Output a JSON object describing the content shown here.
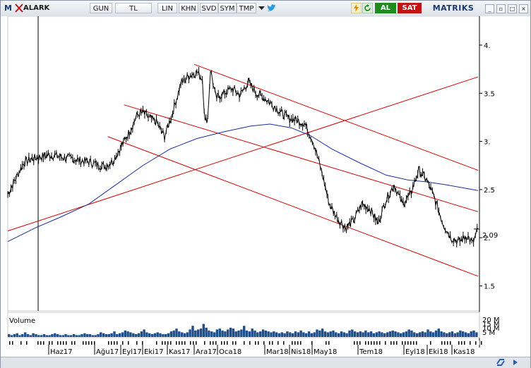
{
  "toolbar": {
    "menu_logo": "M",
    "symbol": "ALARK",
    "period": "GUN",
    "currency": "TL",
    "scale": "LIN",
    "khn": "KHN",
    "svd": "SVD",
    "sym": "SYM",
    "tmp": "TMP",
    "buy_label": "AL",
    "sell_label": "SAT",
    "brand": "MATRIKS",
    "icons": [
      "twitter-icon",
      "lightning-icon",
      "refresh-icon",
      "minimize-icon",
      "restore-icon",
      "close-icon"
    ]
  },
  "colors": {
    "price": "#000000",
    "channel": "#d40000",
    "moving_average": "#1c2b9e",
    "volume": "#1f4e8a",
    "al": "#1f8a1f",
    "sat": "#c01414"
  },
  "volume_panel": {
    "label": "Volume",
    "axis_labels": [
      "20 M",
      "15 M",
      "10 M",
      "5 M"
    ]
  },
  "chart_data": {
    "type": "line",
    "ylabel": "",
    "xlabel": "",
    "ylim": [
      1.3,
      4.5
    ],
    "y_ticks": [
      "4.",
      "3.5",
      "3.",
      "2.5",
      "2.",
      "1.5"
    ],
    "y_tick_values": [
      4.0,
      3.5,
      3.0,
      2.5,
      2.0,
      1.5
    ],
    "last_price_label": "2.09",
    "last_price": 2.09,
    "x_ticks": [
      "Haz17",
      "Ağu17",
      "Eyl17",
      "Eki17",
      "Kas17",
      "Ara17",
      "Oca18",
      "Mar18",
      "Nis18",
      "May18",
      "Tem18",
      "Eyl18",
      "Eki18",
      "Kas18"
    ],
    "series": [
      {
        "points": [
          [
            0,
            2.45
          ],
          [
            3,
            2.62
          ],
          [
            6,
            2.78
          ],
          [
            9,
            2.82
          ],
          [
            12,
            2.84
          ],
          [
            15,
            2.86
          ],
          [
            18,
            2.85
          ],
          [
            21,
            2.83
          ],
          [
            24,
            2.82
          ],
          [
            27,
            2.8
          ],
          [
            30,
            2.79
          ],
          [
            33,
            2.76
          ],
          [
            36,
            2.74
          ],
          [
            39,
            2.8
          ],
          [
            42,
            2.95
          ],
          [
            45,
            3.1
          ],
          [
            48,
            3.28
          ],
          [
            50,
            3.3
          ],
          [
            52,
            3.25
          ],
          [
            55,
            3.2
          ],
          [
            58,
            3.05
          ],
          [
            61,
            3.3
          ],
          [
            64,
            3.6
          ],
          [
            67,
            3.68
          ],
          [
            70,
            3.72
          ],
          [
            72,
            3.65
          ],
          [
            73,
            3.2
          ],
          [
            74,
            3.25
          ],
          [
            75,
            3.75
          ],
          [
            77,
            3.45
          ],
          [
            80,
            3.5
          ],
          [
            83,
            3.55
          ],
          [
            86,
            3.48
          ],
          [
            89,
            3.62
          ],
          [
            92,
            3.5
          ],
          [
            95,
            3.45
          ],
          [
            98,
            3.38
          ],
          [
            101,
            3.3
          ],
          [
            104,
            3.24
          ],
          [
            107,
            3.22
          ],
          [
            110,
            3.18
          ],
          [
            113,
            3.0
          ],
          [
            116,
            2.7
          ],
          [
            119,
            2.35
          ],
          [
            122,
            2.2
          ],
          [
            125,
            2.1
          ],
          [
            128,
            2.18
          ],
          [
            131,
            2.35
          ],
          [
            134,
            2.3
          ],
          [
            137,
            2.15
          ],
          [
            140,
            2.4
          ],
          [
            143,
            2.55
          ],
          [
            146,
            2.35
          ],
          [
            149,
            2.45
          ],
          [
            152,
            2.7
          ],
          [
            155,
            2.6
          ],
          [
            158,
            2.4
          ],
          [
            161,
            2.15
          ],
          [
            164,
            2.0
          ],
          [
            167,
            1.96
          ],
          [
            170,
            2.02
          ],
          [
            172,
            1.94
          ],
          [
            174,
            2.09
          ]
        ]
      },
      {
        "name": "",
        "points": [
          [
            0,
            1.96
          ],
          [
            10,
            2.1
          ],
          [
            20,
            2.22
          ],
          [
            30,
            2.35
          ],
          [
            40,
            2.55
          ],
          [
            50,
            2.75
          ],
          [
            60,
            2.92
          ],
          [
            70,
            3.03
          ],
          [
            80,
            3.1
          ],
          [
            90,
            3.16
          ],
          [
            97,
            3.18
          ],
          [
            105,
            3.14
          ],
          [
            112,
            3.06
          ],
          [
            120,
            2.92
          ],
          [
            130,
            2.78
          ],
          [
            140,
            2.65
          ],
          [
            148,
            2.6
          ],
          [
            155,
            2.58
          ],
          [
            162,
            2.55
          ],
          [
            168,
            2.52
          ],
          [
            174,
            2.49
          ]
        ]
      }
    ],
    "trendlines": [
      {
        "from": [
          0,
          2.07
        ],
        "to": [
          174,
          3.67
        ]
      },
      {
        "from": [
          69,
          3.8
        ],
        "to": [
          174,
          2.7
        ]
      },
      {
        "from": [
          43,
          3.38
        ],
        "to": [
          174,
          2.27
        ]
      },
      {
        "from": [
          37,
          3.05
        ],
        "to": [
          174,
          1.6
        ]
      }
    ],
    "volume": [
      3,
      2,
      3,
      4,
      2,
      3,
      5,
      3,
      2,
      4,
      3,
      2,
      2,
      3,
      2,
      2,
      3,
      4,
      3,
      2,
      2,
      3,
      2,
      2,
      3,
      2,
      2,
      3,
      4,
      3,
      3,
      2,
      2,
      3,
      5,
      4,
      3,
      3,
      4,
      6,
      3,
      4,
      5,
      7,
      6,
      5,
      4,
      3,
      4,
      6,
      8,
      5,
      4,
      3,
      4,
      5,
      4,
      3,
      3,
      4,
      6,
      7,
      9,
      6,
      5,
      4,
      5,
      8,
      12,
      7,
      8,
      9,
      14,
      10,
      7,
      6,
      5,
      8,
      9,
      7,
      6,
      8,
      10,
      9,
      6,
      7,
      8,
      12,
      7,
      6,
      9,
      7,
      5,
      6,
      8,
      7,
      6,
      5,
      6,
      5,
      4,
      5,
      4,
      6,
      5,
      4,
      6,
      5,
      7,
      5,
      4,
      6,
      4,
      5,
      8,
      7,
      9,
      6,
      5,
      6,
      7,
      5,
      4,
      6,
      5,
      4,
      7,
      8,
      6,
      5,
      6,
      5,
      7,
      5,
      6,
      4,
      5,
      6,
      5,
      4,
      5,
      6,
      7,
      6,
      5,
      4,
      5,
      6,
      8,
      7,
      5,
      4,
      5,
      6,
      5,
      8,
      6,
      5,
      7,
      9,
      6,
      5,
      4,
      5,
      6,
      4,
      5,
      7,
      6,
      5,
      4,
      6,
      7,
      5
    ],
    "volume_ylim": [
      0,
      25
    ]
  }
}
